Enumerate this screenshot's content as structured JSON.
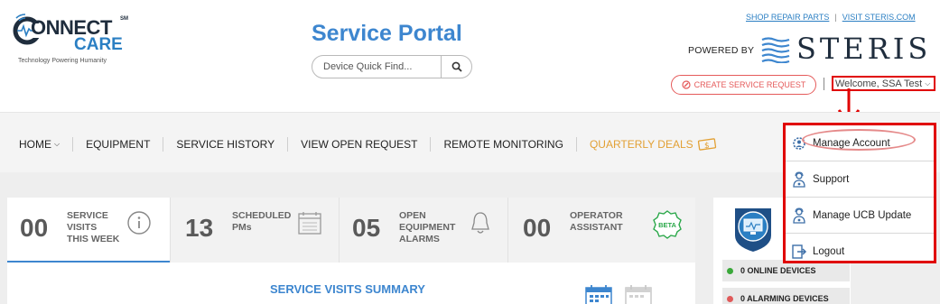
{
  "header": {
    "logo_line1": "ONNECT",
    "logo_sm": "SM",
    "logo_line2": "CARE",
    "logo_tagline": "Technology Powering Humanity",
    "title": "Service Portal",
    "search_placeholder": "Device Quick Find...",
    "link_shop": "SHOP REPAIR PARTS",
    "link_separator": "|",
    "link_visit": "VISIT STERIS.COM",
    "powered_by": "POWERED BY",
    "brand": "STERIS",
    "create_request": "CREATE SERVICE REQUEST",
    "welcome": "Welcome, SSA Test"
  },
  "nav": {
    "items": [
      {
        "label": "HOME"
      },
      {
        "label": "EQUIPMENT"
      },
      {
        "label": "SERVICE HISTORY"
      },
      {
        "label": "VIEW OPEN REQUEST"
      },
      {
        "label": "REMOTE MONITORING"
      },
      {
        "label": "QUARTERLY DEALS"
      }
    ]
  },
  "user_menu": {
    "items": [
      {
        "label": "Manage Account",
        "icon": "gear-person-icon"
      },
      {
        "label": "Support",
        "icon": "support-person-icon"
      },
      {
        "label": "Manage UCB Update",
        "icon": "support-person-icon"
      },
      {
        "label": "Logout",
        "icon": "logout-icon"
      }
    ]
  },
  "stats": [
    {
      "value": "00",
      "label_lines": [
        "SERVICE",
        "VISITS",
        "THIS WEEK"
      ],
      "icon": "info-icon"
    },
    {
      "value": "13",
      "label_lines": [
        "SCHEDULED",
        "PMs"
      ],
      "icon": "calendar-icon"
    },
    {
      "value": "05",
      "label_lines": [
        "OPEN",
        "EQUIPMENT",
        "ALARMS"
      ],
      "icon": "bell-icon"
    },
    {
      "value": "00",
      "label_lines": [
        "OPERATOR",
        "ASSISTANT"
      ],
      "icon": "beta-badge-icon",
      "badge": "BETA"
    }
  ],
  "summary": {
    "title": "SERVICE VISITS SUMMARY"
  },
  "devices": {
    "rows": [
      {
        "label": "0 ONLINE DEVICES",
        "color": "#3aa83a"
      },
      {
        "label": "0 ALARMING DEVICES",
        "color": "#e05a5a"
      }
    ]
  },
  "colors": {
    "accent_blue": "#3d86cf",
    "annotation_red": "#e00000",
    "deals_orange": "#e2a034"
  }
}
